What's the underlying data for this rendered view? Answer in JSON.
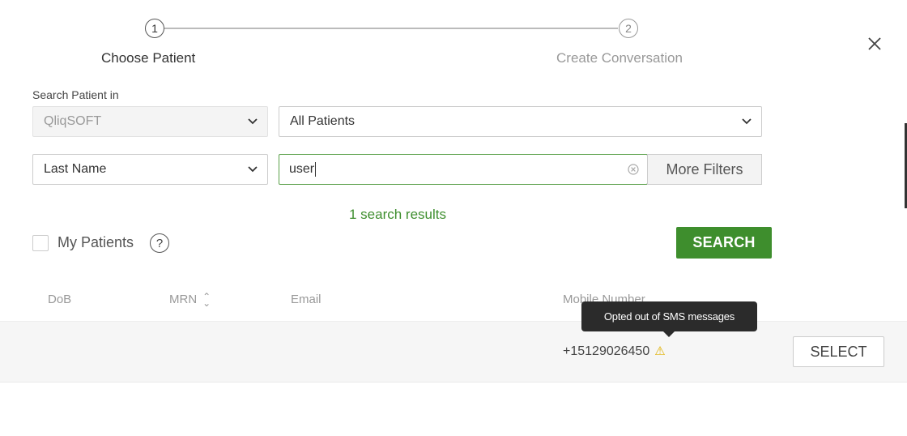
{
  "stepper": {
    "step1": {
      "number": "1",
      "label": "Choose Patient"
    },
    "step2": {
      "number": "2",
      "label": "Create Conversation"
    }
  },
  "close_icon": "close-icon",
  "search": {
    "label": "Search Patient in",
    "organization": "QliqSOFT",
    "patient_scope": "All Patients",
    "filter_field": "Last Name",
    "query": "user",
    "more_filters": "More Filters",
    "results_text": "1 search results"
  },
  "my_patients": {
    "label": "My Patients",
    "checked": false,
    "help_glyph": "?"
  },
  "search_button": "SEARCH",
  "table": {
    "headers": [
      "DoB",
      "MRN",
      "Email",
      "Mobile Number"
    ],
    "rows": [
      {
        "dob": "",
        "mrn": "",
        "email": "",
        "mobile": "+15129026450",
        "warning_icon": "warning-icon"
      }
    ]
  },
  "select_button": "SELECT",
  "tooltip": "Opted out of SMS messages",
  "colors": {
    "accent_green": "#3e8e2d",
    "results_green": "#3f8f2f",
    "warning": "#e0b000"
  }
}
